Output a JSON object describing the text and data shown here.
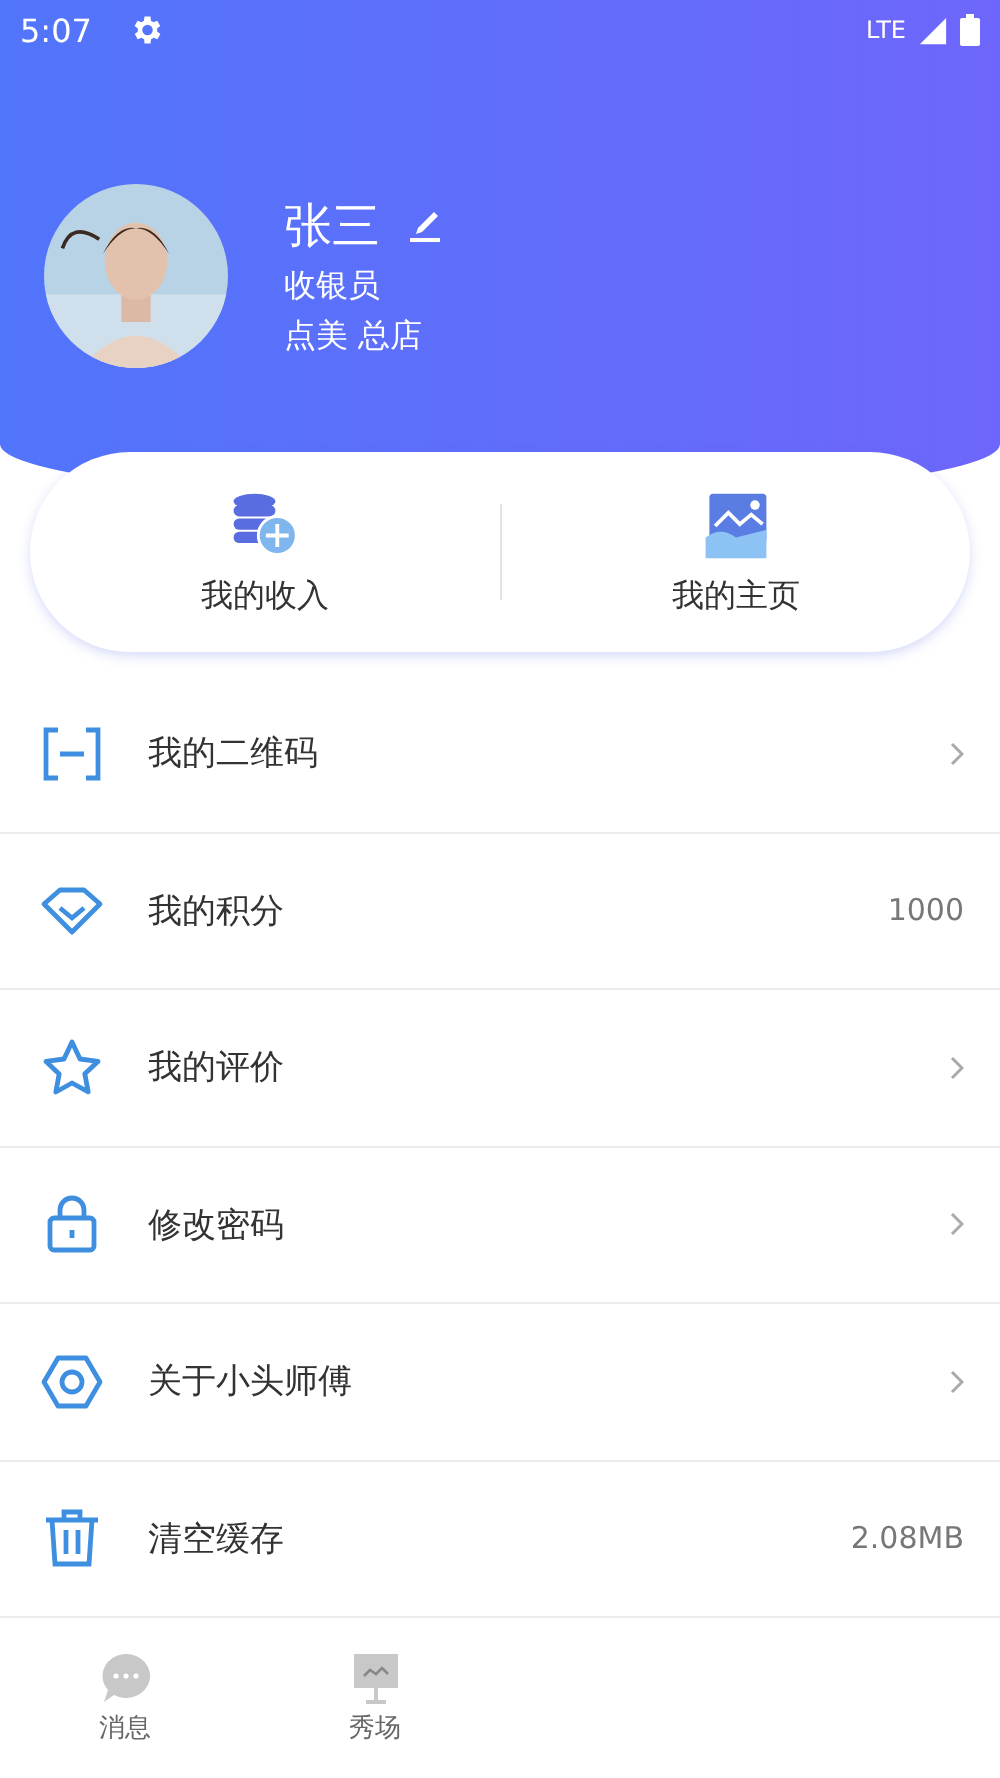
{
  "status_bar": {
    "time": "5:07",
    "network": "LTE"
  },
  "profile": {
    "name": "张三",
    "role": "收银员",
    "store": "点美 总店"
  },
  "shortcuts": [
    {
      "label": "我的收入",
      "kind": "income"
    },
    {
      "label": "我的主页",
      "kind": "homepage"
    }
  ],
  "menu": [
    {
      "label": "我的二维码",
      "kind": "qr"
    },
    {
      "label": "我的积分",
      "kind": "points",
      "value": "1000"
    },
    {
      "label": "我的评价",
      "kind": "reviews"
    },
    {
      "label": "修改密码",
      "kind": "password"
    },
    {
      "label": "关于小头师傅",
      "kind": "about"
    },
    {
      "label": "清空缓存",
      "kind": "cache",
      "value": "2.08MB"
    }
  ],
  "bottom_nav": [
    {
      "label": "消息",
      "kind": "messages"
    },
    {
      "label": "秀场",
      "kind": "show"
    }
  ]
}
